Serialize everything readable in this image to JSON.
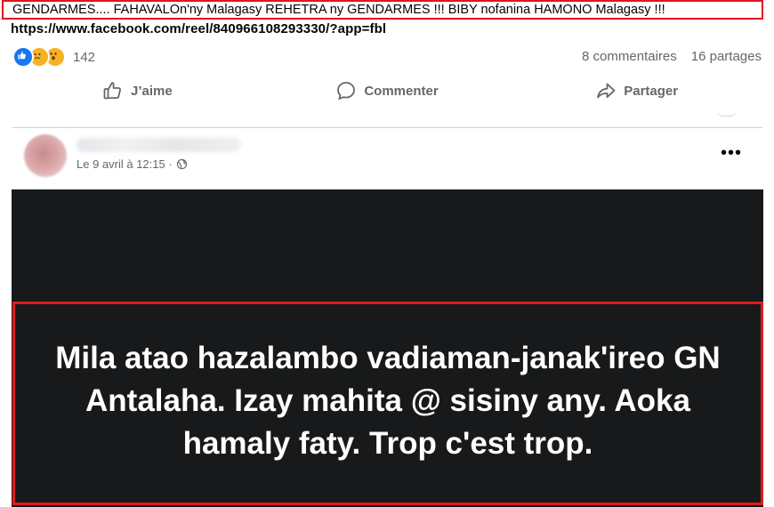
{
  "headline": "GENDARMES.... FAHAVALOn'ny Malagasy REHETRA ny GENDARMES !!! BIBY nofanina HAMONO Malagasy !!!",
  "link": "https://www.facebook.com/reel/840966108293330/?app=fbl",
  "reactions": {
    "icons": [
      "like-icon",
      "sad-icon",
      "wow-icon"
    ],
    "count": "142",
    "comments": "8 commentaires",
    "shares": "16 partages"
  },
  "actions": {
    "like": "J’aime",
    "comment": "Commenter",
    "share": "Partager"
  },
  "post": {
    "timestamp": "Le 9 avril à 12:15 ·",
    "privacy_icon": "globe-icon",
    "more_label": "•••"
  },
  "media": {
    "caption": "Mila atao hazalambo vadiaman-janak'ireo GN Antalaha. Izay mahita @ sisiny any. Aoka hamaly faty. Trop c'est trop."
  },
  "colors": {
    "highlight_border": "#e0141e",
    "facebook_blue": "#1877f2",
    "media_background": "#18191a",
    "secondary_text": "#65676b"
  }
}
